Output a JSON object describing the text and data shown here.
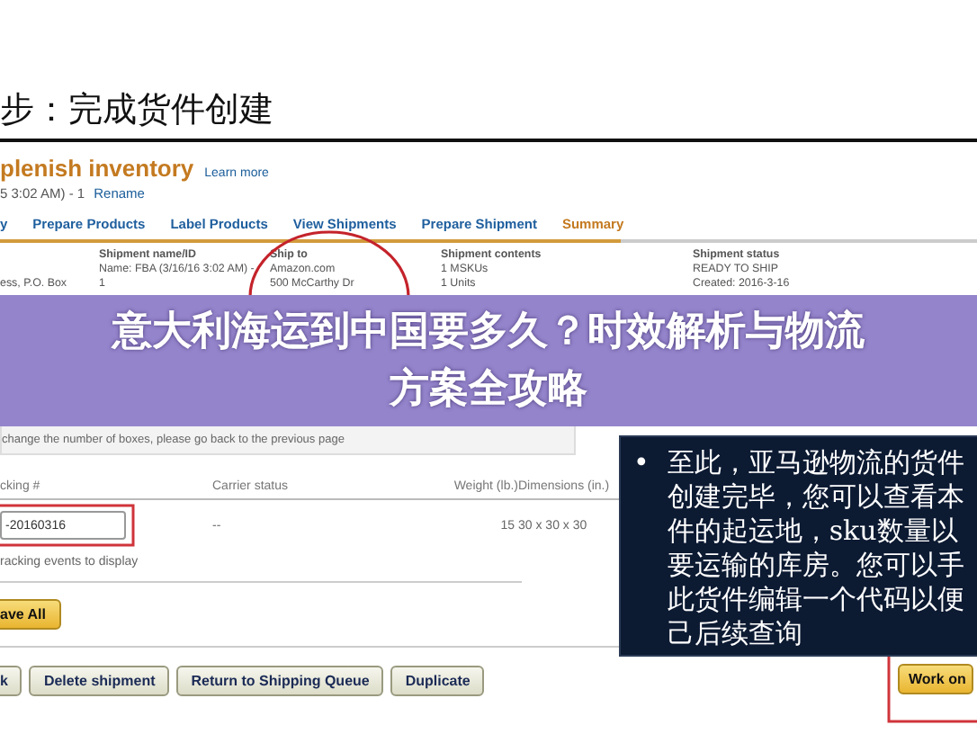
{
  "slide_title": "步：完成货件创建",
  "page": {
    "title": "plenish inventory",
    "learn_more": "Learn more",
    "subtitle": "5 3:02 AM) - 1",
    "rename": "Rename"
  },
  "tabs": [
    {
      "label": "y",
      "selected": false
    },
    {
      "label": "Prepare Products",
      "selected": false
    },
    {
      "label": "Label Products",
      "selected": false
    },
    {
      "label": "View Shipments",
      "selected": false
    },
    {
      "label": "Prepare Shipment",
      "selected": false
    },
    {
      "label": "Summary",
      "selected": true
    }
  ],
  "info_columns": [
    {
      "lines": [
        "ess, P.O. Box"
      ]
    },
    {
      "heading": "Shipment name/ID",
      "lines": [
        "Name: FBA (3/16/16 3:02 AM) -",
        "1"
      ]
    },
    {
      "heading": "Ship to",
      "lines": [
        "Amazon.com",
        "500 McCarthy Dr"
      ]
    },
    {
      "heading": "Shipment contents",
      "lines": [
        "1 MSKUs",
        "1 Units"
      ]
    },
    {
      "heading": "Shipment status",
      "lines": [
        "READY TO SHIP",
        "Created: 2016-3-16"
      ]
    }
  ],
  "notice": "change the number of boxes, please go back to the previous page",
  "table": {
    "columns": [
      "cking #",
      "Carrier status",
      "Weight (lb.)",
      "Dimensions (in.)"
    ],
    "rows": [
      {
        "tracking": "-20160316",
        "carrier_status": "--",
        "weight": "15",
        "dimensions": "30 x 30 x 30"
      }
    ],
    "note": "racking events to display"
  },
  "save_button": "ave All",
  "buttons": [
    "k",
    "Delete shipment",
    "Return to Shipping Queue",
    "Duplicate"
  ],
  "work_button": "Work on",
  "notes": [
    {
      "bullet": "•",
      "lines": [
        "至此，亚马逊物流的货件",
        "创建完毕，您可以查看本",
        "件的起运地，sku数量以",
        "要运输的库房。您可以手",
        "此货件编辑一个代码以便",
        "己后续查询"
      ]
    }
  ],
  "banner": {
    "lines": [
      "意大利海运到中国要多久？时效解析与物流",
      "方案全攻略"
    ]
  }
}
